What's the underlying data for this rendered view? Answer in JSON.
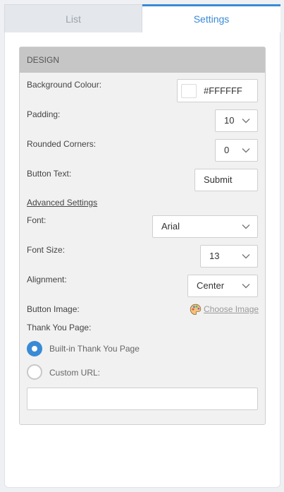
{
  "tabs": [
    {
      "label": "List",
      "active": false
    },
    {
      "label": "Settings",
      "active": true
    }
  ],
  "design": {
    "header": "DESIGN",
    "background_colour": {
      "label": "Background Colour:",
      "value": "#FFFFFF"
    },
    "padding": {
      "label": "Padding:",
      "value": "10"
    },
    "rounded_corners": {
      "label": "Rounded Corners:",
      "value": "0"
    },
    "button_text": {
      "label": "Button Text:",
      "value": "Submit"
    },
    "advanced_settings_link": "Advanced Settings",
    "font": {
      "label": "Font:",
      "value": "Arial"
    },
    "font_size": {
      "label": "Font Size:",
      "value": "13"
    },
    "alignment": {
      "label": "Alignment:",
      "value": "Center"
    },
    "button_image": {
      "label": "Button Image:",
      "link": "Choose Image",
      "icon": "palette-icon"
    },
    "thank_you_page": {
      "label": "Thank You Page:",
      "options": [
        {
          "label": "Built-in Thank You Page",
          "selected": true
        },
        {
          "label": "Custom URL:",
          "selected": false
        }
      ],
      "custom_url_value": ""
    }
  },
  "colors": {
    "accent": "#3a8ad6",
    "header_bg": "#c6c6c6",
    "panel_bg": "#f1f1f1"
  }
}
